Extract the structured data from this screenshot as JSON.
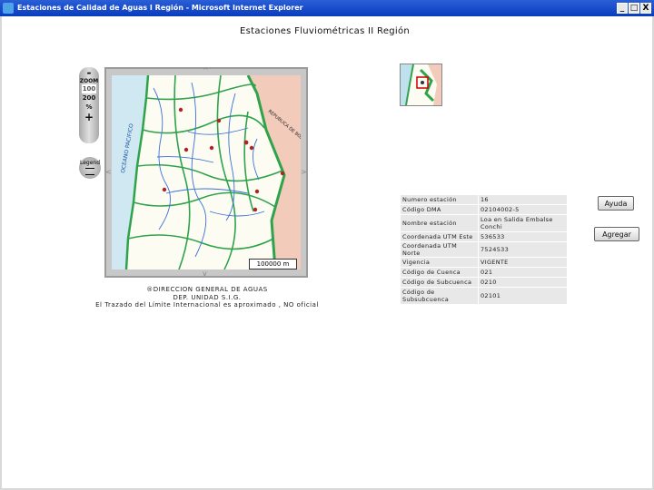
{
  "window": {
    "title": "Estaciones de Calidad de Aguas I Región - Microsoft Internet Explorer",
    "controls": {
      "minimize": "_",
      "maximize": "□",
      "close": "X"
    }
  },
  "page": {
    "title": "Estaciones Fluviométricas II Región"
  },
  "zoom": {
    "minus": "-",
    "label": "ZOOM",
    "level_1": "100",
    "level_2": "200",
    "percent": "%",
    "plus": "+"
  },
  "legend": {
    "label": "Legend"
  },
  "map": {
    "scale_label": "100000 m",
    "labels": [
      "OCEANO PACIFICO",
      "REPUBLICA DE BOLIVIA"
    ],
    "colors": {
      "ocean": "#cfe8f2",
      "land": "#fdfcf3",
      "bolivia": "#f2cbbb",
      "boundary": "#2ea34a",
      "rivers": "#3a6fd8",
      "stations": "#b22222"
    }
  },
  "credit": {
    "line1": "®DIRECCION GENERAL DE AGUAS",
    "line2": "DEP. UNIDAD S.I.G.",
    "line3": "El Trazado del Límite Internacional es aproximado , NO oficial"
  },
  "station_info": {
    "rows": [
      {
        "key": "Numero estación",
        "value": "16"
      },
      {
        "key": "Código DMA",
        "value": "02104002-5"
      },
      {
        "key": "Nombre estación",
        "value": "Loa en Salida Embalse Conchi"
      },
      {
        "key": "Coordenada UTM Este",
        "value": "536533"
      },
      {
        "key": "Coordenada UTM Norte",
        "value": "7524533"
      },
      {
        "key": "Vigencia",
        "value": "VIGENTE"
      },
      {
        "key": "Código de Cuenca",
        "value": "021"
      },
      {
        "key": "Código de Subcuenca",
        "value": "0210"
      },
      {
        "key": "Código de Subsubcuenca",
        "value": "02101"
      }
    ]
  },
  "buttons": {
    "help": "Ayuda",
    "add": "Agregar"
  }
}
